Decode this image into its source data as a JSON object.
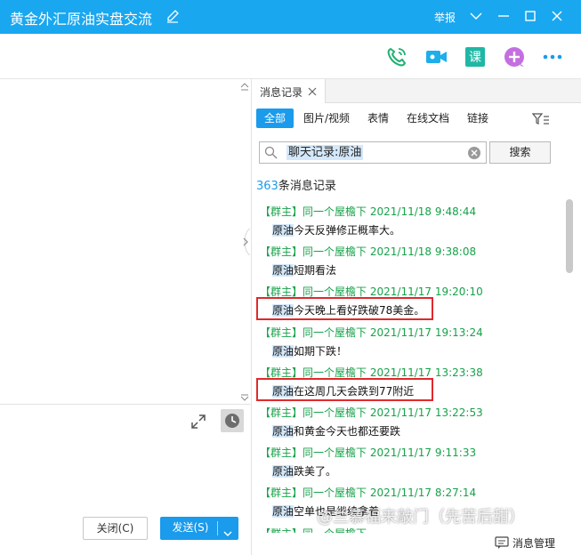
{
  "window": {
    "title": "黄金外汇原油实盘交流",
    "report_label": "举报",
    "icons": [
      "edit-icon",
      "chevron-down-icon",
      "minimize-icon",
      "maximize-icon",
      "close-icon"
    ]
  },
  "toolbar": {
    "buttons": [
      "phone-call-icon",
      "video-call-icon",
      "course-icon",
      "add-app-icon",
      "more-icon"
    ],
    "course_label": "课"
  },
  "chat_input": {
    "close_label": "关闭(C)",
    "send_label": "发送(S)"
  },
  "history": {
    "tab_label": "消息记录",
    "filters": [
      "全部",
      "图片/视频",
      "表情",
      "在线文档",
      "链接"
    ],
    "active_filter": "全部",
    "search_value": "聊天记录:原油",
    "search_button": "搜索",
    "count_number": "363",
    "count_suffix": "条消息记录",
    "messages": [
      {
        "tag": "【群主】",
        "sender": "同一个屋檐下",
        "time": "2021/11/18 9:48:44",
        "keyword": "原油",
        "rest": "今天反弹修正概率大。",
        "highlighted_box": false
      },
      {
        "tag": "【群主】",
        "sender": "同一个屋檐下",
        "time": "2021/11/18 9:38:08",
        "keyword": "原油",
        "rest": "短期看法",
        "highlighted_box": false
      },
      {
        "tag": "【群主】",
        "sender": "同一个屋檐下",
        "time": "2021/11/17 19:20:10",
        "keyword": "原油",
        "rest": "今天晚上看好跌破78美金。",
        "highlighted_box": true
      },
      {
        "tag": "【群主】",
        "sender": "同一个屋檐下",
        "time": "2021/11/17 19:13:24",
        "keyword": "原油",
        "rest": "如期下跌！",
        "highlighted_box": false
      },
      {
        "tag": "【群主】",
        "sender": "同一个屋檐下",
        "time": "2021/11/17 13:23:38",
        "keyword": "原油",
        "rest": "在这周几天会跌到77附近",
        "highlighted_box": true
      },
      {
        "tag": "【群主】",
        "sender": "同一个屋檐下",
        "time": "2021/11/17 13:22:53",
        "keyword": "原油",
        "rest": "和黄金今天也都还要跌",
        "highlighted_box": false
      },
      {
        "tag": "【群主】",
        "sender": "同一个屋檐下",
        "time": "2021/11/17 9:11:33",
        "keyword": "原油",
        "rest": "跌美了。",
        "highlighted_box": false
      },
      {
        "tag": "【群主】",
        "sender": "同一个屋檐下",
        "time": "2021/11/17 8:27:14",
        "keyword": "原油",
        "rest": "空单也是继续拿着",
        "highlighted_box": false
      },
      {
        "tag": "【群主】",
        "sender": "同一个屋檐下",
        "time": "",
        "keyword": "",
        "rest": "",
        "highlighted_box": false
      }
    ],
    "manage_label": "消息管理"
  },
  "watermark": "@兰慕福来敲门（先苦后甜）",
  "colors": {
    "title_bar": "#19a7f0",
    "accent": "#1a9bec",
    "sender_green": "#17a24a",
    "highlight_box": "#e0292b",
    "keyword_bg": "#d4e8fb"
  }
}
